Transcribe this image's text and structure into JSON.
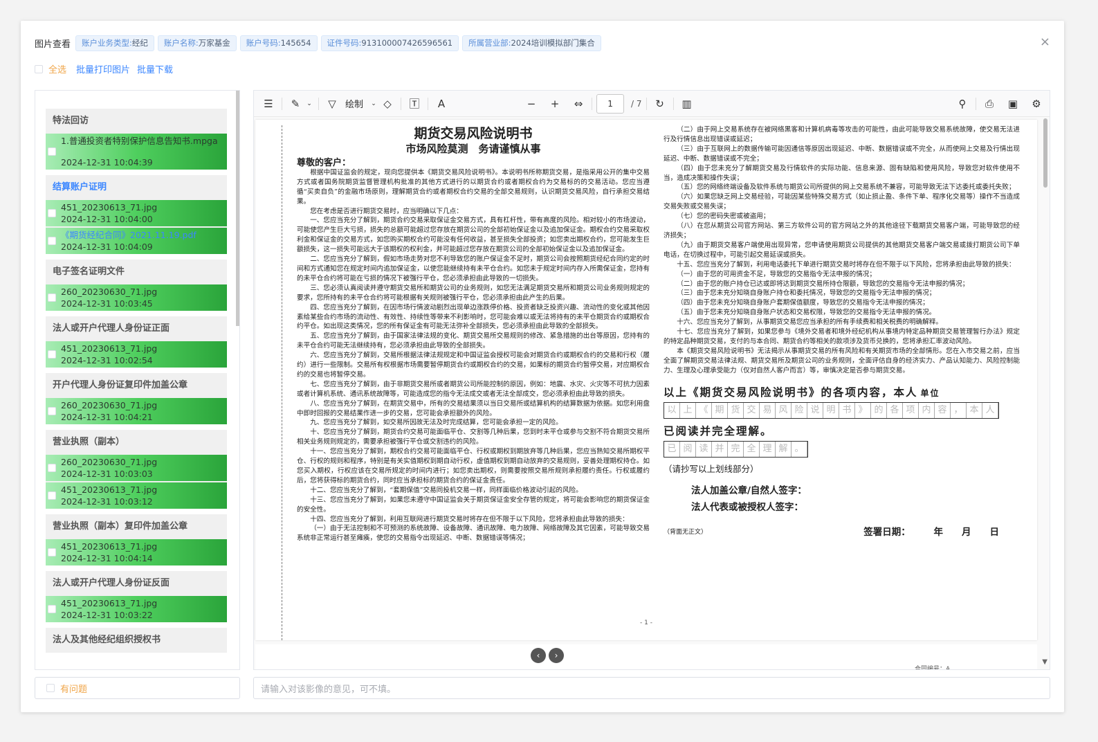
{
  "header": {
    "title": "图片查看",
    "tags": [
      {
        "label": "账户业务类型:",
        "value": "经纪"
      },
      {
        "label": "账户名称:",
        "value": "万家基金"
      },
      {
        "label": "账户号码:",
        "value": "145654"
      },
      {
        "label": "证件号码:",
        "value": "913100007426596561"
      },
      {
        "label": "所属营业部:",
        "value": "2024培训模拟部门集合"
      }
    ],
    "close": "×"
  },
  "toolbar": {
    "select_all": "全选",
    "batch_print": "批量打印图片",
    "batch_download": "批量下载"
  },
  "groups": [
    {
      "title": "特法回访",
      "items": [
        {
          "name": "1.普通投资者特别保护信息告知书.mpga",
          "date": "2024-12-31 10:04:39"
        }
      ]
    },
    {
      "title": "结算账户证明",
      "items": [
        {
          "name": "451_20230613_71.jpg",
          "date": "2024-12-31 10:04:00"
        },
        {
          "name": "《期货经纪合同》2021.11.19.pdf",
          "date": "2024-12-31 10:04:09"
        }
      ]
    },
    {
      "title": "电子签名证明文件",
      "items": [
        {
          "name": "260_20230630_71.jpg",
          "date": "2024-12-31 10:03:45"
        }
      ]
    },
    {
      "title": "法人或开户代理人身份证正面",
      "items": [
        {
          "name": "451_20230613_71.jpg",
          "date": "2024-12-31 10:02:54"
        }
      ]
    },
    {
      "title": "开户代理人身份证复印件加盖公章",
      "items": [
        {
          "name": "260_20230630_71.jpg",
          "date": "2024-12-31 10:04:21"
        }
      ]
    },
    {
      "title": "营业执照（副本）",
      "items": [
        {
          "name": "260_20230630_71.jpg",
          "date": "2024-12-31 10:03:03"
        },
        {
          "name": "451_20230613_71.jpg",
          "date": "2024-12-31 10:03:12"
        }
      ]
    },
    {
      "title": "营业执照（副本）复印件加盖公章",
      "items": [
        {
          "name": "451_20230613_71.jpg",
          "date": "2024-12-31 10:04:14"
        }
      ]
    },
    {
      "title": "法人或开户代理人身份证反面",
      "items": [
        {
          "name": "451_20230613_71.jpg",
          "date": "2024-12-31 10:03:22"
        }
      ]
    },
    {
      "title": "法人及其他经纪组织授权书",
      "items": []
    }
  ],
  "viewer": {
    "draw_label": "绘制",
    "page_value": "1",
    "page_total": "/ 7",
    "doc": {
      "title": "期货交易风险说明书",
      "subtitle": "市场风险莫测　务请谨慎从事",
      "greeting": "尊敬的客户：",
      "left_paragraphs": [
        "根据中国证监会的规定，现向您提供本《期货交易风险说明书》。本说明书所称期货交易，是指采用公开的集中交易方式或者国务院期货监督管理机构批准的其他方式进行的以期货合约或者期权合约为交易标的的交易活动。您应当遵循“买卖自负”的金融市场原则，理解期货合约或者期权合约交易的全部交易规则，认识期货交易风险，自行承担交易结果。",
        "您在考虑是否进行期货交易时，应当明确以下几点：",
        "一、您应当充分了解到，期货合约交易采取保证金交易方式，具有杠杆性，带有高度的风险。相对较小的市场波动，可能使您产生巨大亏损，损失的总额可能超过您存放在期货公司的全部初始保证金以及追加保证金。期权合约交易采取权利金和保证金的交易方式，如您购买期权合约可能没有任何收益，甚至损失全部投资；如您卖出期权合约，您可能发生巨额损失，这一损失可能远大于该期权的权利金，并可能超过您存放在期货公司的全部初始保证金以及追加保证金。",
        "二、您应当充分了解到，假如市场走势对您不利导致您的账户保证金不足时，期货公司会按照期货经纪合同约定的时间和方式通知您在规定时间内追加保证金，以使您能继续持有未平仓合约。如您未于规定时间内存入所需保证金，您持有的未平仓合约将可能在亏损的情况下被强行平仓，您必须承担由此导致的一切损失。",
        "三、您必须认真阅读并遵守期货交易所和期货公司的业务规则，如您无法满足期货交易所和期货公司业务规则规定的要求，您所持有的未平仓合约将可能根据有关规则被强行平仓，您必须承担由此产生的后果。",
        "四、您应当充分了解到，在因市场行情波动剧烈出现单边涨跌停价格、投资者缺乏投资兴趣、流动性的变化或其他因素给某些合约市场的流动性、有效性、持续性等带来不利影响时，您可能会难以或无法将持有的未平仓期货合约或期权合约平仓。如出现这类情况，您的所有保证金有可能无法弥补全部损失，您必须承担由此导致的全部损失。",
        "五、您应当充分了解到，由于国家法律法规的变化、期货交易所交易规则的修改、紧急措施的出台等原因，您持有的未平仓合约可能无法继续持有，您必须承担由此导致的全部损失。",
        "六、您应当充分了解到，交易所根据法律法规规定和中国证监会授权可能会对期货合约或期权合约的交易和行权（履约）进行一些限制。交易所有权根据市场需要暂停期货合约或期权合约的交易，如果标的期货合约暂停交易，对应期权合约的交易也将暂停交易。",
        "七、您应当充分了解到，由于非期货交易所或者期货公司所能控制的原因，例如：地震、水灾、火灾等不可抗力因素或者计算机系统、通讯系统故障等，可能造成您的指令无法成交或者无法全部成交，您必须承担由此导致的损失。",
        "八、您应当充分了解到，在期货交易中，所有的交易结果须以当日交易所或结算机构的结算数据为依据。如您利用盘中即时回报的交易结果作进一步的交易，您可能会承担额外的风险。",
        "九、您应当充分了解到，如交易所因故无法及时完成结算，您可能会承担一定的风险。",
        "十、您应当充分了解到，期货合约交易可能面临平仓、交割等几种后果，您到时未平仓或参与交割不符合期货交易所相关业务规则规定的，需要承担被强行平仓或交割违约的风险。",
        "十一、您应当充分了解到，期权合约交易可能面临平仓、行权或期权到期放弃等几种后果，您应当熟知交易所期权平仓、行权的规则和程序，特别是有关实值期权到期自动行权，虚值期权到期自动放弃的交易规则，妥善处理期权持仓。如您买入期权，行权应该在交易所规定的时间内进行；如您卖出期权，则需要按照交易所规则承担履约责任。行权或履约后，您将获得标的期货合约，同时应当承担标的期货合约的保证金责任。",
        "十二、您应当充分了解到，“套期保值”交易同投机交易一样，同样面临价格波动引起的风险。",
        "十三、您应当充分了解到，如果您未遵守中国证监会关于期货保证金安全存管的规定，将可能会影响您的期货保证金的安全性。",
        "十四、您应当充分了解到，利用互联网进行期货交易时将存在但不限于以下风险，您将承担由此导致的损失：",
        "（一）由于无法控制和不可预测的系统故障、设备故障、通讯故障、电力故障、网络故障及其它因素，可能导致交易系统非正常运行甚至瘫痪，使您的交易指令出现延迟、中断、数据错误等情况；"
      ],
      "right_paragraphs": [
        "（二）由于网上交易系统存在被网络黑客和计算机病毒等攻击的可能性，由此可能导致交易系统故障，使交易无法进行及行情信息出现错误或延迟；",
        "（三）由于互联网上的数据传输可能因通信等原因出现延迟、中断、数据错误或不完全，从而使网上交易及行情出现延迟、中断、数据错误或不完全；",
        "（四）由于您未充分了解期货交易及行情软件的实际功能、信息来源、固有缺陷和使用风险，导致您对软件使用不当，造成决策和操作失误；",
        "（五）您的网络终端设备及软件系统与期货公司所提供的网上交易系统不兼容，可能导致无法下达委托或委托失败；",
        "（六）如果您缺乏网上交易经验，可能因某些特殊交易方式（如止损止盈、条件下单、程序化交易等）操作不当造成交易失败或交易失误；",
        "（七）您的密码失密或被盗用；",
        "（八）在您从期货公司官方网站、第三方软件公司的官方网站之外的其他途径下载期货交易客户端，可能导致您的经济损失；",
        "（九）由于期货交易客户端使用出现异常，您申请使用期货公司提供的其他期货交易客户端交易或拨打期货公司下单电话，在切换过程中，可能引起交易延误或损失。",
        "十五、您应当充分了解到，利用电话委托下单进行期货交易时将存在但不限于以下风险，您将承担由此导致的损失：",
        "（一）由于您的可用资金不足，导致您的交易指令无法申报的情况；",
        "（二）由于您的账户持仓已达或即将达到期货交易所持仓限额，导致您的交易指令无法申报的情况；",
        "（三）由于您未充分知晓自身账户持仓和委托情况，导致您的交易指令无法申报的情况；",
        "（四）由于您未充分知晓自身账户套期保值额度，导致您的交易指令无法申报的情况；",
        "（五）由于您未充分知晓自身账户状态和交易权限，导致您的交易指令无法申报的情况。",
        "十六、您应当充分了解到，从事期货交易您应当承担的所有手续费和相关税费的明确解释。",
        "十七、您应当充分了解到，如果您参与《境外交易者和境外经纪机构从事境内特定品种期货交易管理暂行办法》规定的特定品种期货交易，支付的与本合同、期货合约等相关的款项涉及货币兑换的，您将承担汇率波动风险。",
        "本《期货交易风险说明书》无法揭示从事期货交易的所有风险和有关期货市场的全部情形。您在入市交易之前，应当全面了解期货交易法律法规、期货交易所及期货公司的业务规则，全面评估自身的经济实力、产品认知能力、风险控制能力、生理及心理承受能力（仅对自然人客户而言）等，审慎决定是否参与期货交易。"
      ],
      "statement_line1": "以上《期货交易风险说明书》的各项内容，本人",
      "statement_unit": "单位",
      "copy_chars1": [
        "以",
        "上",
        "《",
        "期",
        "货",
        "交",
        "易",
        "风",
        "险",
        "说",
        "明",
        "书",
        "》",
        "的",
        "各",
        "项",
        "内",
        "容",
        "，",
        "本",
        "人"
      ],
      "statement_line2": "已阅读并完全理解。",
      "copy_chars2": [
        "已",
        "阅",
        "读",
        "并",
        "完",
        "全",
        "理",
        "解",
        "。"
      ],
      "copy_note": "（请抄写以上划线部分）",
      "sig1": "法人加盖公章/自然人签字：",
      "sig2": "法人代表或被授权人签字：",
      "date_label": "签署日期：　　　年　　月　　日",
      "back_blank": "（背面无正文）",
      "page_number": "- 1 -",
      "contract_no": "合同编号：A"
    }
  },
  "bottom": {
    "problem_label": "有问题",
    "opinion_placeholder": "请输入对该影像的意见，可不填。"
  }
}
